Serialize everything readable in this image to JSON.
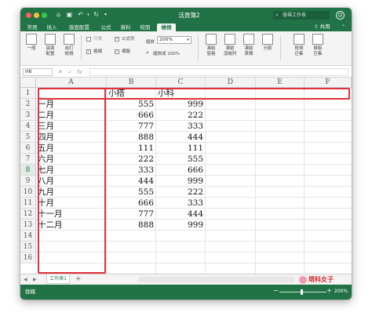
{
  "window": {
    "title": "活頁簿2"
  },
  "search": {
    "placeholder": "搜尋工作表"
  },
  "share": {
    "label": "共用"
  },
  "ribbon": {
    "tabs": [
      "常用",
      "插入",
      "版面配置",
      "公式",
      "資料",
      "校閱",
      "檢視"
    ],
    "active_tab": "檢視",
    "view_buttons": [
      {
        "label": "一般"
      },
      {
        "label": "頁面\n配置"
      },
      {
        "label": "自訂\n檢視"
      }
    ],
    "checks": {
      "ruler": "尺規",
      "formula_bar": "公式列",
      "gridlines": "格線",
      "headings": "標題"
    },
    "zoom_label": "縮放",
    "zoom_value": "200%",
    "zoom_selection": "縮放成 100%",
    "freeze_buttons": [
      {
        "label": "凍結\n窗格"
      },
      {
        "label": "凍結\n頂端列"
      },
      {
        "label": "凍結\n首欄"
      },
      {
        "label": "分割"
      }
    ],
    "macro_buttons": [
      {
        "label": "檢視\n巨集"
      },
      {
        "label": "錄製\n巨集"
      }
    ]
  },
  "formula_bar": {
    "cell_ref": "H8",
    "cancel": "✕",
    "confirm": "✓",
    "fx": "fx",
    "value": ""
  },
  "columns": [
    "A",
    "B",
    "C",
    "D",
    "E",
    "F"
  ],
  "rows": [
    "1",
    "2",
    "3",
    "4",
    "5",
    "6",
    "7",
    "8",
    "9",
    "10",
    "11",
    "12",
    "13",
    "14",
    "15",
    "16"
  ],
  "selected_row": "8",
  "sheet": {
    "header": {
      "b": "小搭",
      "c": "小科"
    },
    "data": [
      {
        "a": "一月",
        "b": "555",
        "c": "999"
      },
      {
        "a": "二月",
        "b": "666",
        "c": "222"
      },
      {
        "a": "三月",
        "b": "777",
        "c": "333"
      },
      {
        "a": "四月",
        "b": "888",
        "c": "444"
      },
      {
        "a": "五月",
        "b": "111",
        "c": "111"
      },
      {
        "a": "六月",
        "b": "222",
        "c": "555"
      },
      {
        "a": "七月",
        "b": "333",
        "c": "666"
      },
      {
        "a": "八月",
        "b": "444",
        "c": "999"
      },
      {
        "a": "九月",
        "b": "555",
        "c": "222"
      },
      {
        "a": "十月",
        "b": "666",
        "c": "333"
      },
      {
        "a": "十一月",
        "b": "777",
        "c": "444"
      },
      {
        "a": "十二月",
        "b": "888",
        "c": "999"
      }
    ]
  },
  "sheet_tabs": [
    {
      "label": "工作表1"
    }
  ],
  "watermark": {
    "text": "塔科女子"
  },
  "status": {
    "text": "就緒",
    "zoom": "200%"
  },
  "colors": {
    "excel_green": "#217346",
    "highlight_red": "#e0323c"
  }
}
